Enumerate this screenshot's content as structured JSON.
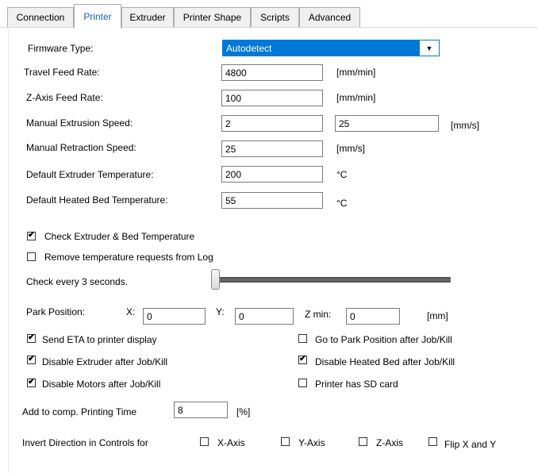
{
  "tabs": [
    "Connection",
    "Printer",
    "Extruder",
    "Printer Shape",
    "Scripts",
    "Advanced"
  ],
  "firmware": {
    "label": "Firmware Type:",
    "value": "Autodetect"
  },
  "travel": {
    "label": "Travel Feed Rate:",
    "value": "4800",
    "unit": "[mm/min]"
  },
  "zaxis": {
    "label": "Z-Axis Feed Rate:",
    "value": "100",
    "unit": "[mm/min]"
  },
  "manual_extrusion": {
    "label": "Manual Extrusion Speed:",
    "value1": "2",
    "value2": "25",
    "unit": "[mm/s]"
  },
  "manual_retraction": {
    "label": "Manual Retraction Speed:",
    "value": "25",
    "unit": "[mm/s]"
  },
  "extruder_temp": {
    "label": "Default Extruder Temperature:",
    "value": "200",
    "unit": "°C"
  },
  "bed_temp": {
    "label": "Default Heated Bed Temperature:",
    "value": "55",
    "unit": "°C"
  },
  "check_temp": {
    "label": "Check Extruder & Bed Temperature",
    "checked": true
  },
  "remove_requests": {
    "label": "Remove temperature requests from Log",
    "checked": false
  },
  "check_every": {
    "label": "Check every 3 seconds.",
    "slider_fraction": 0.0
  },
  "park": {
    "label": "Park Position:",
    "x_label": "X:",
    "x_value": "0",
    "y_label": "Y:",
    "y_value": "0",
    "zmin_label": "Z min:",
    "zmin_value": "0",
    "unit": "[mm]"
  },
  "checkboxes": {
    "send_eta": {
      "label": "Send ETA to printer display",
      "checked": true
    },
    "disable_extruder": {
      "label": "Disable Extruder after Job/Kill",
      "checked": true
    },
    "disable_motors": {
      "label": "Disable Motors after Job/Kill",
      "checked": true
    },
    "go_to_park": {
      "label": "Go to Park Position after Job/Kill",
      "checked": false
    },
    "disable_bed": {
      "label": "Disable Heated Bed after Job/Kill",
      "checked": true
    },
    "sd_card": {
      "label": "Printer has SD card",
      "checked": false
    }
  },
  "comp_time": {
    "label": "Add to comp. Printing Time",
    "value": "8",
    "unit": "[%]"
  },
  "invert": {
    "label": "Invert Direction in Controls for",
    "x": {
      "label": "X-Axis",
      "checked": false
    },
    "y": {
      "label": "Y-Axis",
      "checked": false
    },
    "z": {
      "label": "Z-Axis",
      "checked": false
    },
    "flip": {
      "label": "Flip X and Y",
      "checked": false
    }
  },
  "check_glyph": "✔"
}
